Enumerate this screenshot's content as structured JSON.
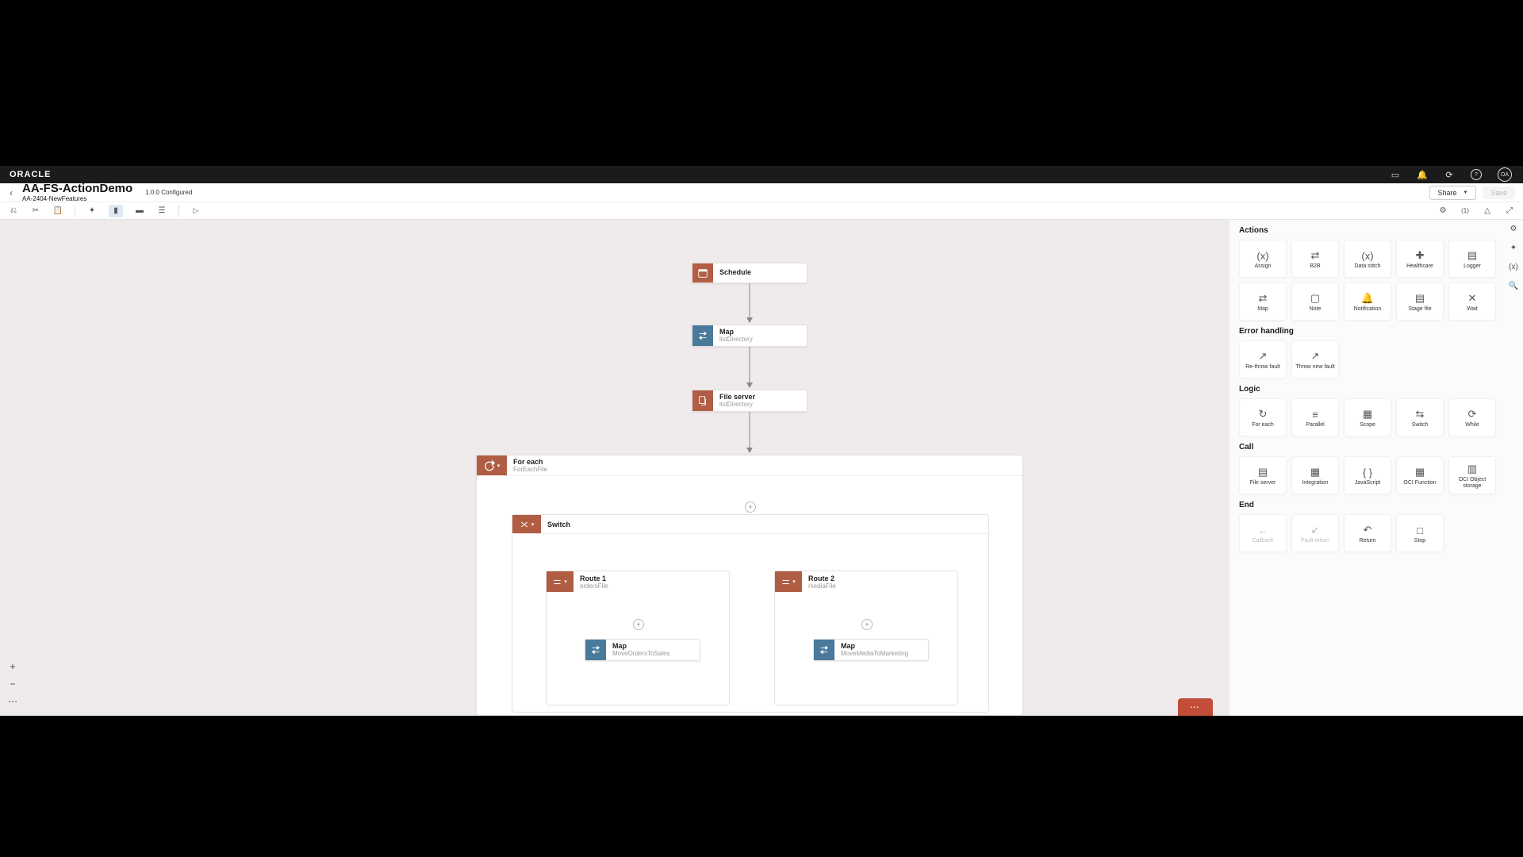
{
  "brand": "ORACLE",
  "avatar_initials": "OA",
  "header": {
    "title": "AA-FS-ActionDemo",
    "subtitle": "AA-2404-NewFeatures",
    "status": "1.0.0 Configured",
    "share_label": "Share",
    "save_label": "Save"
  },
  "toolbar_counter": "(1)",
  "panel": {
    "sections": {
      "actions": "Actions",
      "error": "Error handling",
      "logic": "Logic",
      "call": "Call",
      "end": "End"
    },
    "actions": [
      "Assign",
      "B2B",
      "Data stitch",
      "Healthcare",
      "Logger",
      "Map",
      "Note",
      "Notification",
      "Stage file",
      "Wait"
    ],
    "error": [
      "Re-throw fault",
      "Throw new fault"
    ],
    "logic": [
      "For each",
      "Parallel",
      "Scope",
      "Switch",
      "While"
    ],
    "call": [
      "File server",
      "Integration",
      "JavaScript",
      "OCI Function",
      "OCI Object storage"
    ],
    "end": [
      "Callback",
      "Fault return",
      "Return",
      "Stop"
    ]
  },
  "flow": {
    "schedule": {
      "title": "Schedule"
    },
    "map1": {
      "title": "Map",
      "sub": "listDirectory"
    },
    "file_server": {
      "title": "File server",
      "sub": "listDirectory"
    },
    "foreach": {
      "title": "For each",
      "sub": "ForEachFile"
    },
    "switch": {
      "title": "Switch"
    },
    "route1": {
      "title": "Route 1",
      "sub": "ordersFile"
    },
    "route2": {
      "title": "Route 2",
      "sub": "mediaFile"
    },
    "map_r1": {
      "title": "Map",
      "sub": "MoveOrdersToSales"
    },
    "map_r2": {
      "title": "Map",
      "sub": "MoveMediaToMarketing"
    }
  }
}
